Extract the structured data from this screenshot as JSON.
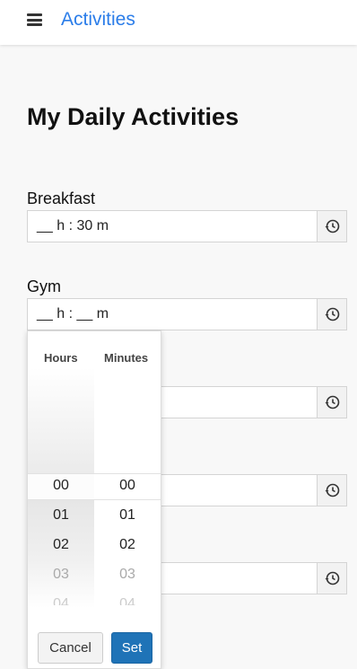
{
  "header": {
    "title": "Activities",
    "menu_icon": "hamburger-menu-icon"
  },
  "page": {
    "title": "My Daily Activities"
  },
  "fields": [
    {
      "label": "Breakfast",
      "value": "__ h : 30 m"
    },
    {
      "label": "Gym",
      "value": "__ h : __ m"
    },
    {
      "label": "",
      "value": ""
    },
    {
      "label": "",
      "value": ""
    },
    {
      "label": "",
      "value": ""
    }
  ],
  "picker": {
    "hours_header": "Hours",
    "minutes_header": "Minutes",
    "hours": [
      "00",
      "01",
      "02",
      "03",
      "04"
    ],
    "minutes": [
      "00",
      "01",
      "02",
      "03",
      "04"
    ],
    "cancel_label": "Cancel",
    "set_label": "Set"
  },
  "colors": {
    "accent": "#2b7de9",
    "set_button": "#1f73b7"
  }
}
